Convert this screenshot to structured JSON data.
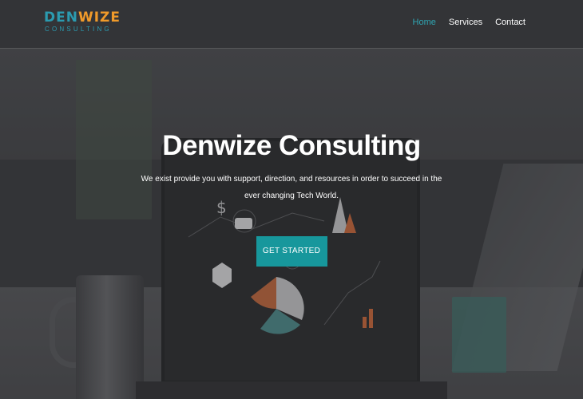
{
  "brand": {
    "logo_part1": "DEN",
    "logo_part2": "WIZE",
    "logo_sub": "CONSULTING",
    "colors": {
      "teal": "#2b9bb0",
      "orange": "#f09a2a"
    }
  },
  "nav": {
    "items": [
      {
        "label": "Home",
        "active": true
      },
      {
        "label": "Services",
        "active": false
      },
      {
        "label": "Contact",
        "active": false
      }
    ],
    "active_color": "#2fa6b3"
  },
  "hero": {
    "title": "Denwize Consulting",
    "description": "We exist provide you with support, direction, and resources in order to succeed in the ever changing Tech World.",
    "cta_label": "GET STARTED",
    "cta_color": "#17979c"
  }
}
